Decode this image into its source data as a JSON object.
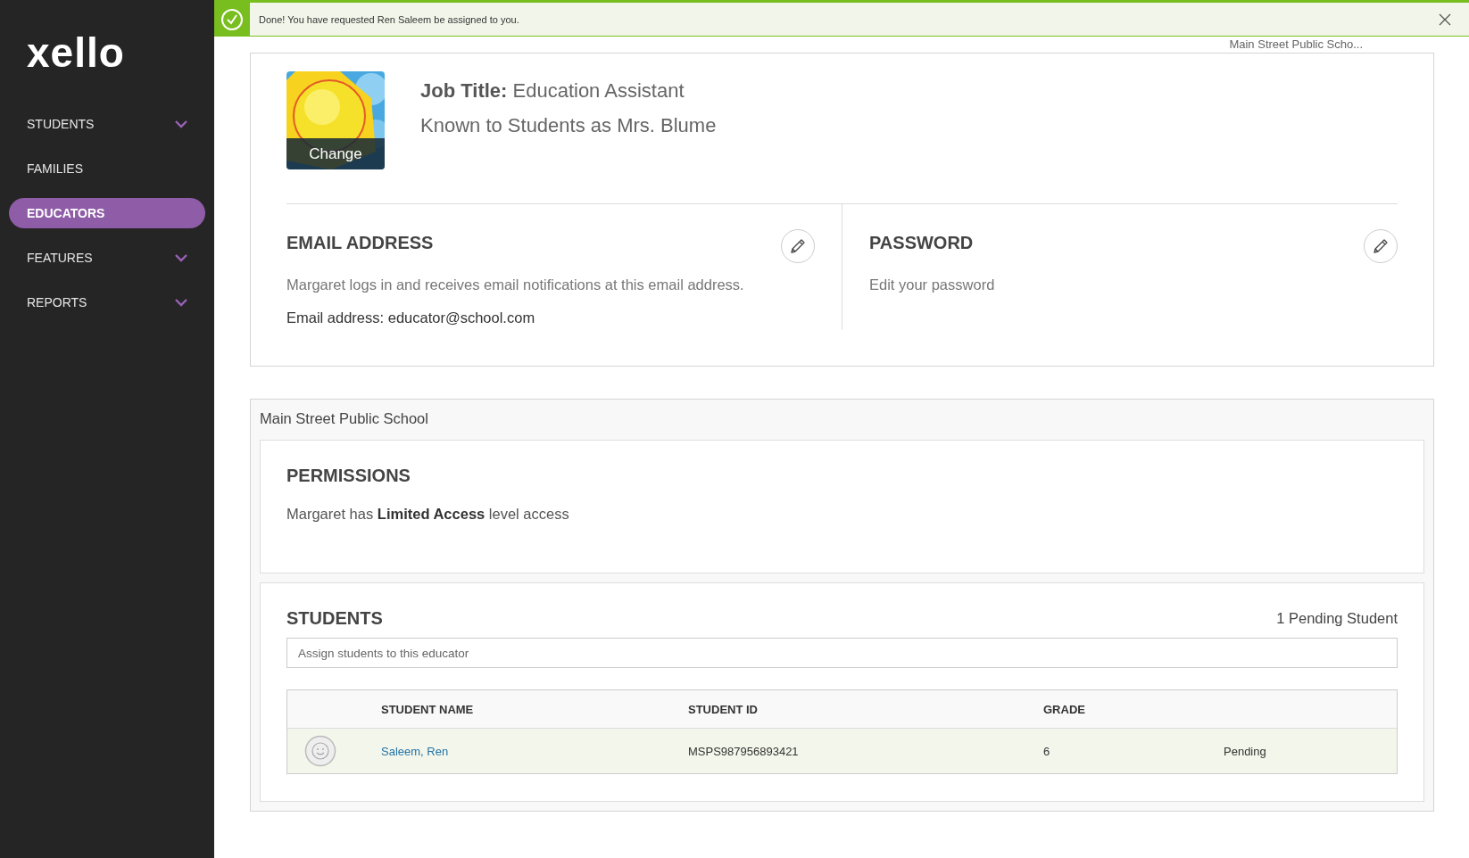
{
  "notification": {
    "message": "Done! You have requested Ren Saleem be assigned to you."
  },
  "sidebar": {
    "logo": "xello",
    "items": [
      {
        "label": "STUDENTS",
        "expandable": true,
        "selected": false
      },
      {
        "label": "FAMILIES",
        "expandable": false,
        "selected": false
      },
      {
        "label": "EDUCATORS",
        "expandable": false,
        "selected": true
      },
      {
        "label": "FEATURES",
        "expandable": true,
        "selected": false
      },
      {
        "label": "REPORTS",
        "expandable": true,
        "selected": false
      }
    ]
  },
  "header": {
    "school": "Main Street Public Scho..."
  },
  "profile": {
    "photo_action": "Change",
    "job_title": "**Job Title:** Education Assistant",
    "known_as": "Known to Students as Mrs. Blume"
  },
  "email": {
    "heading": "EMAIL ADDRESS",
    "description": "Margaret logs in and receives email notifications at this email address.",
    "address_line": "Email address: educator@school.com"
  },
  "password": {
    "heading": "PASSWORD",
    "description": "Edit your password"
  },
  "school": {
    "name": "Main Street Public School",
    "permissions": {
      "heading": "PERMISSIONS",
      "text": "Margaret has **Limited Access** level access"
    },
    "students": {
      "heading": "STUDENTS",
      "pending_count": "1 Pending Student",
      "search_placeholder": "Assign students to this educator",
      "columns": [
        "STUDENT NAME",
        "STUDENT ID",
        "GRADE"
      ],
      "rows": [
        {
          "name": "Saleem, Ren",
          "student_id": "MSPS987956893421",
          "grade": "6",
          "status": "Pending"
        }
      ]
    }
  }
}
